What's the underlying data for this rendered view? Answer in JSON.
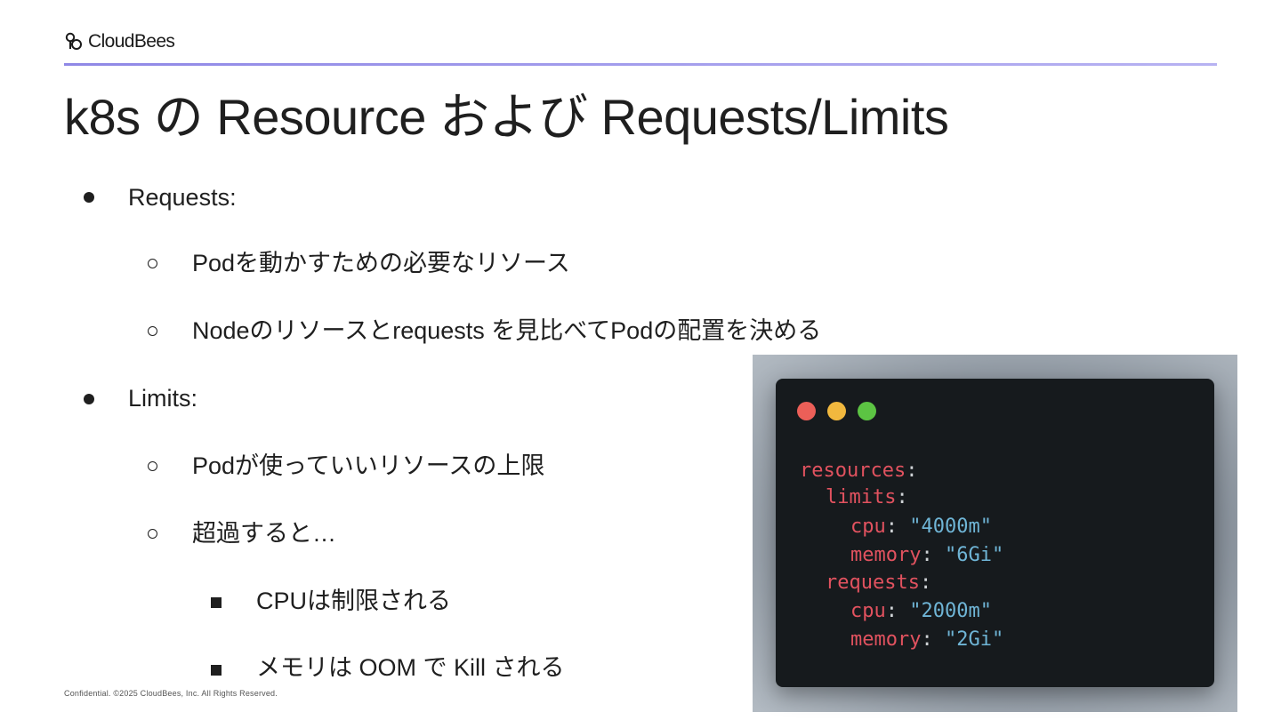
{
  "header": {
    "logo_text": "CloudBees"
  },
  "slide": {
    "title": "k8s の Resource および Requests/Limits"
  },
  "bullets": [
    {
      "level": 1,
      "text": "Requests:"
    },
    {
      "level": 2,
      "text": "Podを動かすための必要なリソース"
    },
    {
      "level": 2,
      "text": "Nodeのリソースとrequests を見比べてPodの配置を決める"
    },
    {
      "level": 1,
      "text": "Limits:"
    },
    {
      "level": 2,
      "text": "Podが使っていいリソースの上限"
    },
    {
      "level": 2,
      "text": "超過すると…"
    },
    {
      "level": 3,
      "text": "CPUは制限される"
    },
    {
      "level": 3,
      "text": "メモリは OOM で Kill される"
    }
  ],
  "code": {
    "lines": [
      {
        "key": "resources",
        "value": ""
      },
      {
        "key": "limits",
        "value": ""
      },
      {
        "key": "cpu",
        "value": "\"4000m\""
      },
      {
        "key": "memory",
        "value": "\"6Gi\""
      },
      {
        "key": "requests",
        "value": ""
      },
      {
        "key": "cpu",
        "value": "\"2000m\""
      },
      {
        "key": "memory",
        "value": "\"2Gi\""
      }
    ],
    "colors": {
      "key": "#e1525f",
      "value": "#6fb5d6",
      "window": "#161a1d"
    }
  },
  "footer": {
    "text": "Confidential. ©2025 CloudBees, Inc. All Rights Reserved."
  },
  "theme": {
    "accent": "#8f88e6",
    "text": "#1f1f1f"
  }
}
